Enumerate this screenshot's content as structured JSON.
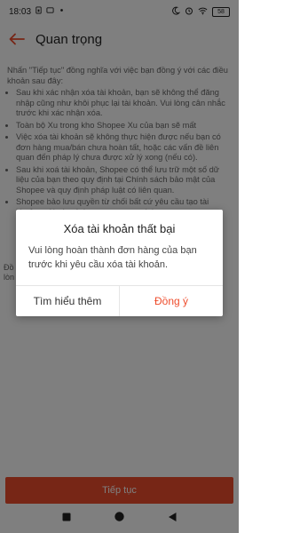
{
  "status_bar": {
    "time": "18:03",
    "battery": "58"
  },
  "header": {
    "title": "Quan trọng"
  },
  "content": {
    "intro": "Nhấn \"Tiếp tục\" đồng nghĩa với việc bạn đồng ý với các điều khoản sau đây:",
    "terms": [
      "Sau khi xác nhận xóa tài khoản, bạn sẽ không thể đăng nhập cũng như khôi phục lại tài khoản. Vui lòng cân nhắc trước khi xác nhận xóa.",
      "Toàn bộ Xu trong kho Shopee Xu của bạn sẽ mất",
      "Việc xóa tài khoản sẽ không thực hiện được nếu bạn có đơn hàng mua/bán chưa hoàn tất, hoặc các vấn đề liên quan đến pháp lý chưa được xử lý xong (nếu có).",
      "Sau khi xoá tài khoản, Shopee có thể lưu trữ một số dữ liệu của bạn theo quy định tại Chính sách bảo mật của Shopee và quy định pháp luật có liên quan.",
      "Shopee bảo lưu quyền từ chối bất cứ yêu cầu tạo tài khoản mới nào từ bạn trong tương lai."
    ],
    "confirm_fragment": "Đồ\nlòn"
  },
  "bottom_button": {
    "label": "Tiếp tục"
  },
  "dialog": {
    "title": "Xóa tài khoản thất bại",
    "message": "Vui lòng hoàn thành đơn hàng của bạn trước khi yêu cầu xóa tài khoản.",
    "secondary_label": "Tìm hiểu thêm",
    "primary_label": "Đồng ý"
  },
  "colors": {
    "accent": "#ee4d2d",
    "overlay": "rgba(0,0,0,0.5)"
  },
  "icons": {
    "status": [
      "moon-icon",
      "alarm-icon",
      "wifi-icon",
      "battery-icon"
    ],
    "nav": [
      "square-icon",
      "circle-icon",
      "triangle-back-icon"
    ]
  }
}
